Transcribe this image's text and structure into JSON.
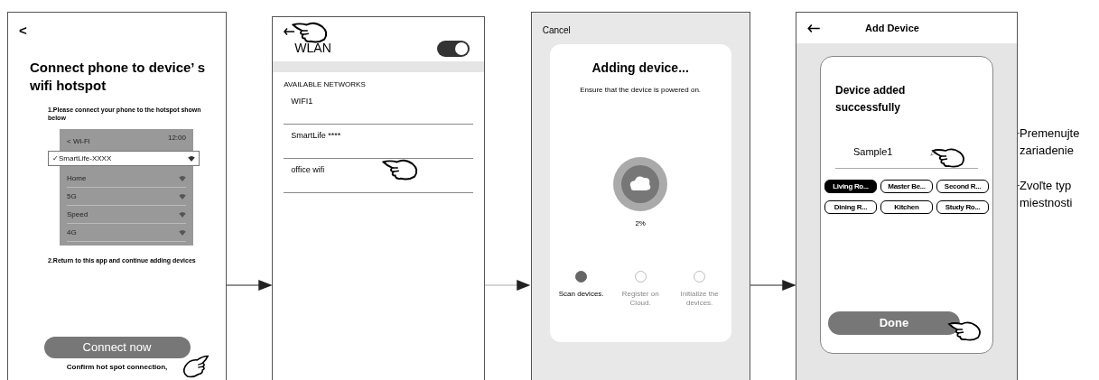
{
  "hotspot_screen": {
    "back": "<",
    "title": "Connect phone to device’ s wifi hotspot",
    "step_1": "1.Please connect your phone to the hotspot shown below",
    "phone_list": {
      "header": "< Wi-Fi",
      "time": "12:00",
      "networks": [
        {
          "name": "✓SmartLife-XXXX",
          "selected": true
        },
        {
          "name": "Home",
          "selected": false
        },
        {
          "name": "5G",
          "selected": false
        },
        {
          "name": "Speed",
          "selected": false
        },
        {
          "name": "4G",
          "selected": false
        }
      ]
    },
    "step_2": "2.Return to this app and continue adding devices",
    "button": "Connect now",
    "footnote": "Confirm hot spot connection,"
  },
  "wlan_screen": {
    "title": "WLAN",
    "wlan_on": true,
    "section": "AVAILABLE NETWORKS",
    "networks": [
      "WIFI1",
      "SmartLife ****",
      "office wifi"
    ]
  },
  "adding_screen": {
    "cancel": "Cancel",
    "title": "Adding device...",
    "subtitle": "Ensure that the device is powered on.",
    "percent": "2%",
    "steps": [
      {
        "label": "Scan devices.",
        "selected": true
      },
      {
        "label": "Register on Cloud.",
        "selected": false
      },
      {
        "label": "Initialize the devices.",
        "selected": false
      }
    ]
  },
  "added_screen": {
    "title": "Add Device",
    "heading": "Device added successfully",
    "device_name": "Sample1",
    "rooms": [
      {
        "label": "Living Ro...",
        "selected": true
      },
      {
        "label": "Master Be...",
        "selected": false
      },
      {
        "label": "Second R...",
        "selected": false
      },
      {
        "label": "Dining R...",
        "selected": false
      },
      {
        "label": "Kitchen",
        "selected": false
      },
      {
        "label": "Study Ro...",
        "selected": false
      }
    ],
    "button": "Done"
  },
  "annotations": [
    "Premenujte zariadenie",
    "Zvoľte typ miestnosti"
  ]
}
